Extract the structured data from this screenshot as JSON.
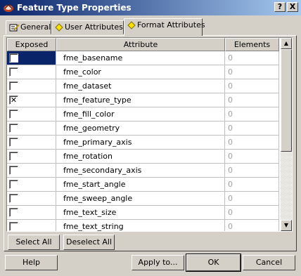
{
  "window": {
    "title": "Feature Type Properties",
    "help_btn": "?",
    "close_btn": "X"
  },
  "tabs": [
    {
      "label": "General",
      "icon": "edit-form-icon",
      "active": false
    },
    {
      "label": "User Attributes",
      "icon": "yellow-diamond-icon",
      "active": false
    },
    {
      "label": "Format Attributes",
      "icon": "yellow-diamond-icon",
      "active": true
    }
  ],
  "grid": {
    "columns": [
      "Exposed",
      "Attribute",
      "Elements"
    ],
    "rows": [
      {
        "exposed": false,
        "attribute": "fme_basename",
        "elements": "0",
        "selected": true
      },
      {
        "exposed": false,
        "attribute": "fme_color",
        "elements": "0"
      },
      {
        "exposed": false,
        "attribute": "fme_dataset",
        "elements": "0"
      },
      {
        "exposed": true,
        "attribute": "fme_feature_type",
        "elements": "0"
      },
      {
        "exposed": false,
        "attribute": "fme_fill_color",
        "elements": "0"
      },
      {
        "exposed": false,
        "attribute": "fme_geometry",
        "elements": "0"
      },
      {
        "exposed": false,
        "attribute": "fme_primary_axis",
        "elements": "0"
      },
      {
        "exposed": false,
        "attribute": "fme_rotation",
        "elements": "0"
      },
      {
        "exposed": false,
        "attribute": "fme_secondary_axis",
        "elements": "0"
      },
      {
        "exposed": false,
        "attribute": "fme_start_angle",
        "elements": "0"
      },
      {
        "exposed": false,
        "attribute": "fme_sweep_angle",
        "elements": "0"
      },
      {
        "exposed": false,
        "attribute": "fme_text_size",
        "elements": "0"
      },
      {
        "exposed": false,
        "attribute": "fme_text_string",
        "elements": "0"
      }
    ]
  },
  "buttons": {
    "select_all": "Select All",
    "deselect_all": "Deselect All",
    "help": "Help",
    "apply_to": "Apply to...",
    "ok": "OK",
    "cancel": "Cancel"
  },
  "colors": {
    "title_start": "#0a246a",
    "title_end": "#a6caf0",
    "face": "#d4d0c8",
    "selection": "#0a246a"
  }
}
